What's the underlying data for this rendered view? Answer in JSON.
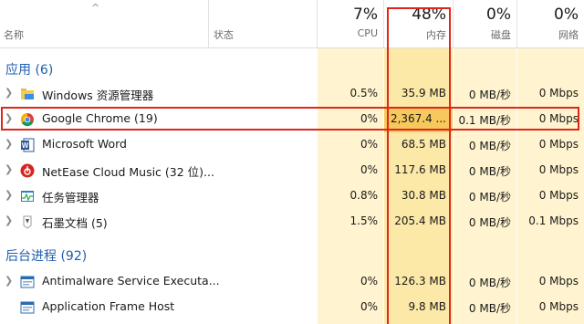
{
  "header": {
    "sort_arrow": "^",
    "name_label": "名称",
    "status_label": "状态",
    "cpu": {
      "pct": "7%",
      "label": "CPU"
    },
    "memory": {
      "pct": "48%",
      "label": "内存"
    },
    "disk": {
      "pct": "0%",
      "label": "磁盘"
    },
    "network": {
      "pct": "0%",
      "label": "网络"
    }
  },
  "colors": {
    "group_title": "#1f5fae",
    "highlight": "#e0261b",
    "usage_light": "#fff4cf",
    "usage_med": "#fce9a8",
    "usage_high": "#f9d77a"
  },
  "groups": [
    {
      "title": "应用 (6)",
      "rows": [
        {
          "icon": "folder-icon",
          "name": "Windows 资源管理器",
          "cpu": "0.5%",
          "memory": "35.9 MB",
          "disk": "0 MB/秒",
          "network": "0 Mbps"
        },
        {
          "icon": "chrome-icon",
          "name": "Google Chrome (19)",
          "cpu": "0%",
          "memory": "2,367.4 ...",
          "disk": "0.1 MB/秒",
          "network": "0 Mbps"
        },
        {
          "icon": "word-icon",
          "name": "Microsoft Word",
          "cpu": "0%",
          "memory": "68.5 MB",
          "disk": "0 MB/秒",
          "network": "0 Mbps"
        },
        {
          "icon": "netease-music-icon",
          "name": "NetEase Cloud Music (32 位)...",
          "cpu": "0%",
          "memory": "117.6 MB",
          "disk": "0 MB/秒",
          "network": "0 Mbps"
        },
        {
          "icon": "task-manager-icon",
          "name": "任务管理器",
          "cpu": "0.8%",
          "memory": "30.8 MB",
          "disk": "0 MB/秒",
          "network": "0 Mbps"
        },
        {
          "icon": "shimo-icon",
          "name": "石墨文档 (5)",
          "cpu": "1.5%",
          "memory": "205.4 MB",
          "disk": "0 MB/秒",
          "network": "0.1 Mbps"
        }
      ]
    },
    {
      "title": "后台进程 (92)",
      "rows": [
        {
          "icon": "service-icon",
          "name": "Antimalware Service Executa...",
          "cpu": "0%",
          "memory": "126.3 MB",
          "disk": "0 MB/秒",
          "network": "0 Mbps"
        },
        {
          "icon": "service-icon",
          "name": "Application Frame Host",
          "cpu": "0%",
          "memory": "9.8 MB",
          "disk": "0 MB/秒",
          "network": "0 Mbps"
        }
      ]
    }
  ]
}
